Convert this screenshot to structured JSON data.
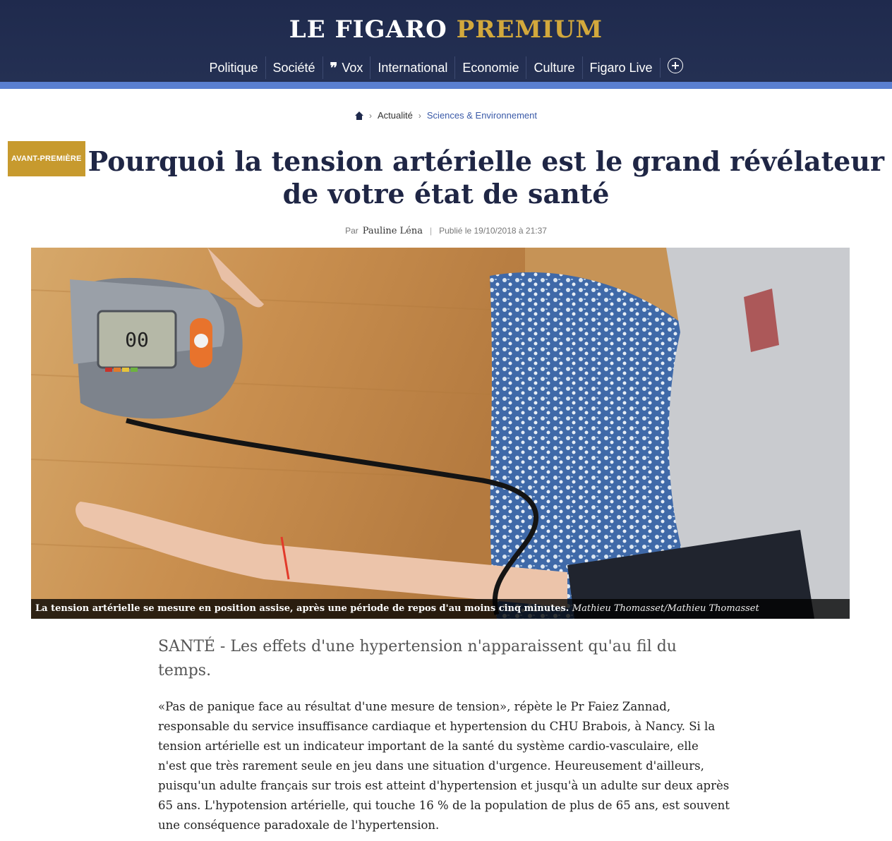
{
  "header": {
    "logo_main": "LE FIGARO",
    "logo_premium": "PREMIUM",
    "nav": [
      "Politique",
      "Société",
      "Vox",
      "International",
      "Economie",
      "Culture",
      "Figaro Live"
    ]
  },
  "breadcrumb": {
    "item1": "Actualité",
    "item2": "Sciences & Environnement"
  },
  "article": {
    "badge": "AVANT-PREMIÈRE",
    "title": "Pourquoi la tension artérielle est le grand révélateur de votre état de santé",
    "by_prefix": "Par",
    "author": "Pauline Léna",
    "published": "Publié le 19/10/2018 à 21:37",
    "caption": "La tension artérielle se mesure en position assise, après une période de repos d'au moins cinq minutes.",
    "caption_credit": "Mathieu Thomasset/Mathieu Thomasset",
    "lead": "SANTÉ - Les effets d'une hypertension n'apparaissent qu'au fil du temps.",
    "paragraph": "«Pas de panique face au résultat d'une mesure de tension», répète le Pr Faiez Zannad, responsable du service insuffisance cardiaque et hypertension du CHU Brabois, à Nancy. Si la tension artérielle est un indicateur important de la santé du système cardio-vasculaire, elle n'est que très rarement seule en jeu dans une situation d'urgence. Heureusement d'ailleurs, puisqu'un adulte français sur trois est atteint d'hypertension et jusqu'à un adulte sur deux après 65 ans. L'hypotension artérielle, qui touche 16 % de la population de plus de 65 ans, est souvent une conséquence paradoxale de l'hypertension."
  },
  "colors": {
    "header_bg": "#1f2a4d",
    "premium_gold": "#d2a83c",
    "accent_strip": "#5a7fd0",
    "badge_gold": "#c79a2e"
  }
}
